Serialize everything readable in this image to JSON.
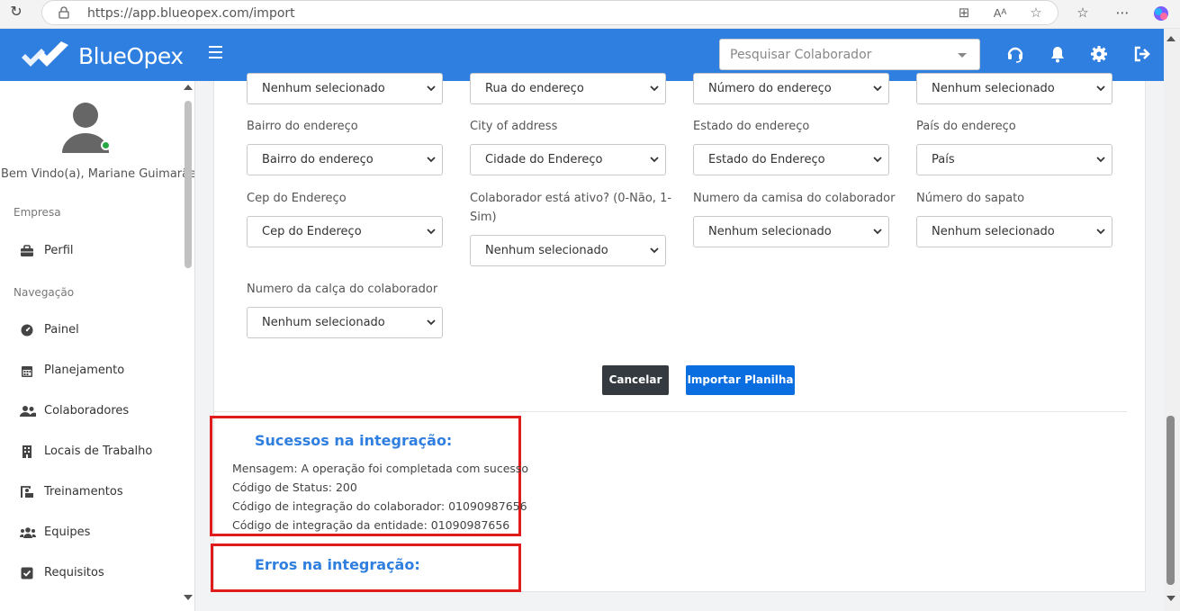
{
  "browser": {
    "url": "https://app.blueopex.com/import"
  },
  "header": {
    "brand": "BlueOpex",
    "search_placeholder": "Pesquisar Colaborador",
    "accent_color": "#2f7fe0"
  },
  "sidebar": {
    "welcome": "Bem Vindo(a), Mariane Guimarães",
    "section_company": "Empresa",
    "section_nav": "Navegação",
    "items": [
      {
        "label": "Perfil",
        "icon": "briefcase-icon"
      },
      {
        "label": "Painel",
        "icon": "gauge-icon"
      },
      {
        "label": "Planejamento",
        "icon": "calendar-icon"
      },
      {
        "label": "Colaboradores",
        "icon": "users-icon"
      },
      {
        "label": "Locais de Trabalho",
        "icon": "building-icon"
      },
      {
        "label": "Treinamentos",
        "icon": "chalkboard-icon"
      },
      {
        "label": "Equipes",
        "icon": "team-icon"
      },
      {
        "label": "Requisitos",
        "icon": "checkbox-icon"
      }
    ]
  },
  "form": {
    "row0": [
      {
        "value": "Nenhum selecionado"
      },
      {
        "value": "Rua do endereço"
      },
      {
        "value": "Número do endereço"
      },
      {
        "value": "Nenhum selecionado"
      }
    ],
    "row1": [
      {
        "label": "Bairro do endereço",
        "value": "Bairro do endereço"
      },
      {
        "label": "City of address",
        "value": "Cidade do Endereço"
      },
      {
        "label": "Estado do endereço",
        "value": "Estado do Endereço"
      },
      {
        "label": "País do endereço",
        "value": "País"
      }
    ],
    "row2": [
      {
        "label": "Cep do Endereço",
        "value": "Cep do Endereço"
      },
      {
        "label_line1": "Colaborador está ativo? (0-Não, 1-",
        "label_line2": "Sim)",
        "value": "Nenhum selecionado"
      },
      {
        "label": "Numero da camisa do colaborador",
        "value": "Nenhum selecionado"
      },
      {
        "label": "Número do sapato",
        "value": "Nenhum selecionado"
      }
    ],
    "row3": [
      {
        "label": "Numero da calça do colaborador",
        "value": "Nenhum selecionado"
      }
    ],
    "cancel_label": "Cancelar",
    "import_label": "Importar Planilha"
  },
  "results": {
    "success_title": "Sucessos na integração:",
    "lines": [
      "Mensagem: A operação foi completada com sucesso",
      "Código de Status: 200",
      "Código de integração do colaborador: 01090987656",
      "Código de integração da entidade: 01090987656"
    ],
    "errors_title": "Erros na integração:",
    "highlight_color": "#e01b1b"
  }
}
